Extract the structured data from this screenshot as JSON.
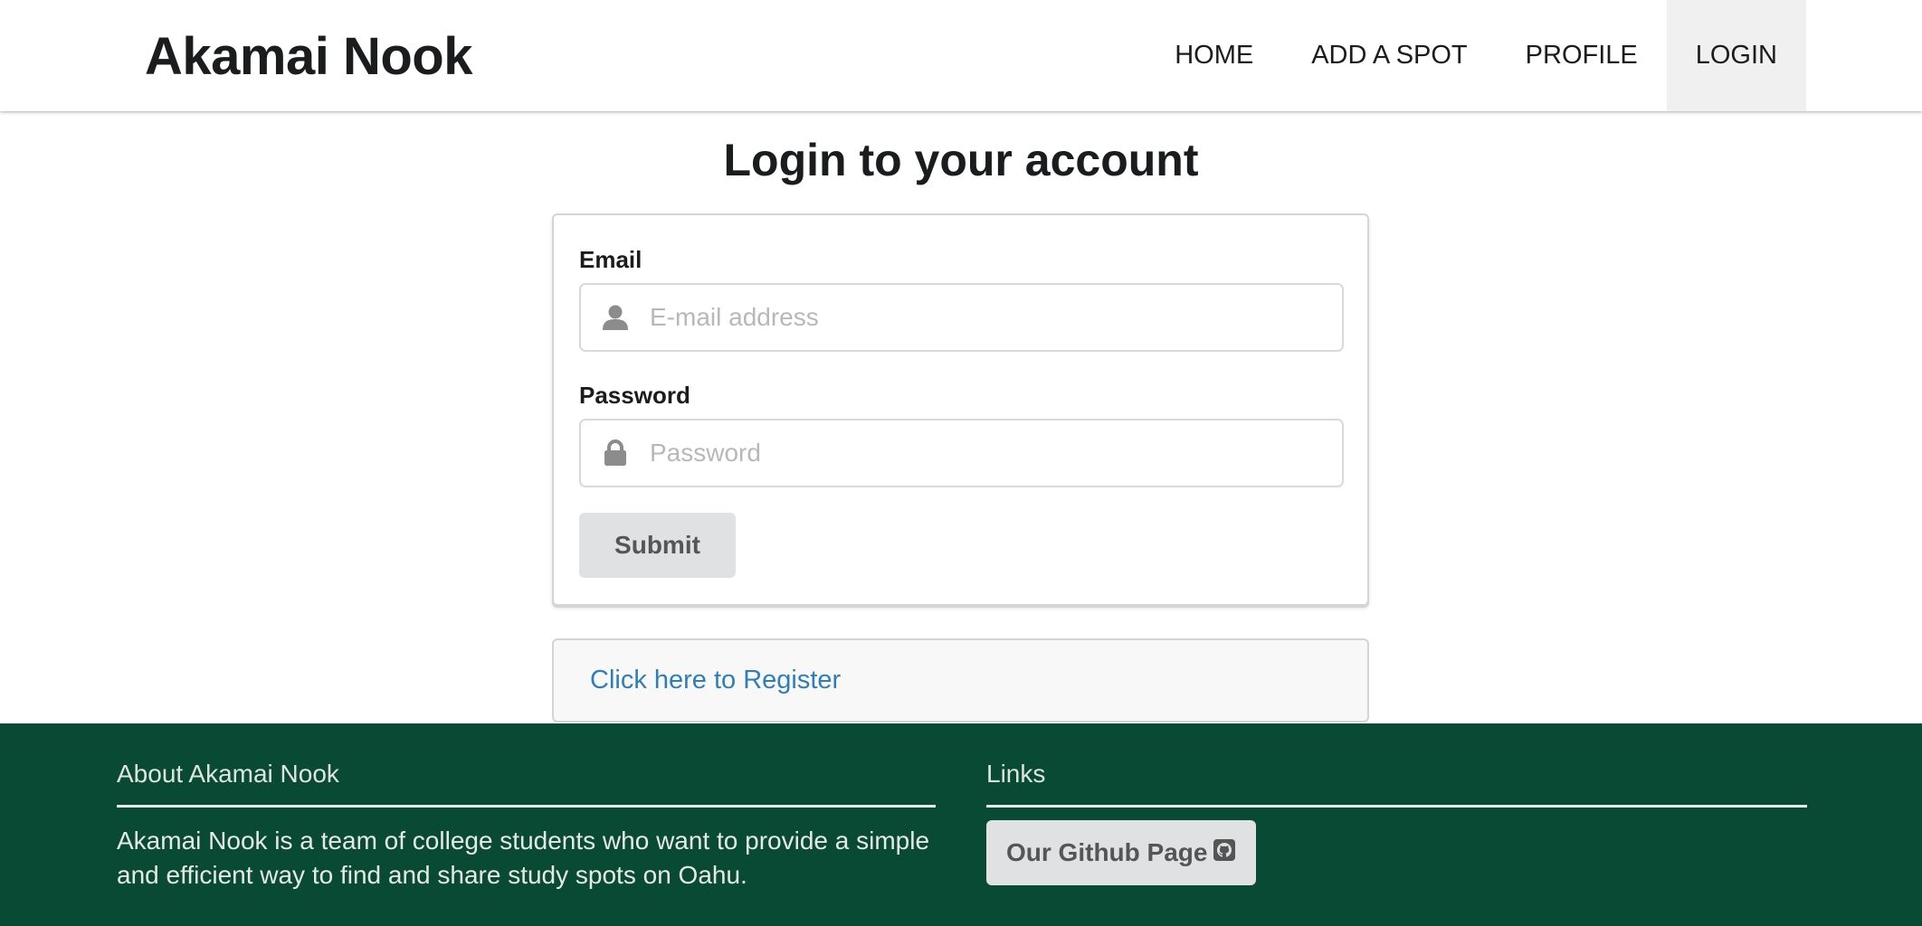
{
  "header": {
    "brand": "Akamai Nook",
    "nav": [
      {
        "label": "HOME"
      },
      {
        "label": "ADD A SPOT"
      },
      {
        "label": "PROFILE"
      },
      {
        "label": "LOGIN",
        "active": true
      }
    ]
  },
  "main": {
    "title": "Login to your account",
    "email": {
      "label": "Email",
      "placeholder": "E-mail address",
      "value": "",
      "icon": "user-icon"
    },
    "password": {
      "label": "Password",
      "placeholder": "Password",
      "value": "",
      "icon": "lock-icon"
    },
    "submit_label": "Submit",
    "register_link": "Click here to Register"
  },
  "footer": {
    "about": {
      "heading": "About Akamai Nook",
      "text": "Akamai Nook is a team of college students who want to provide a simple and efficient way to find and share study spots on Oahu."
    },
    "links": {
      "heading": "Links",
      "github_label": "Our Github Page",
      "github_icon": "github-icon"
    }
  },
  "colors": {
    "footer_bg": "#084a33",
    "link": "#2f7dbc",
    "button_bg": "#e0e1e2",
    "active_nav_bg": "#f0f0f0"
  }
}
